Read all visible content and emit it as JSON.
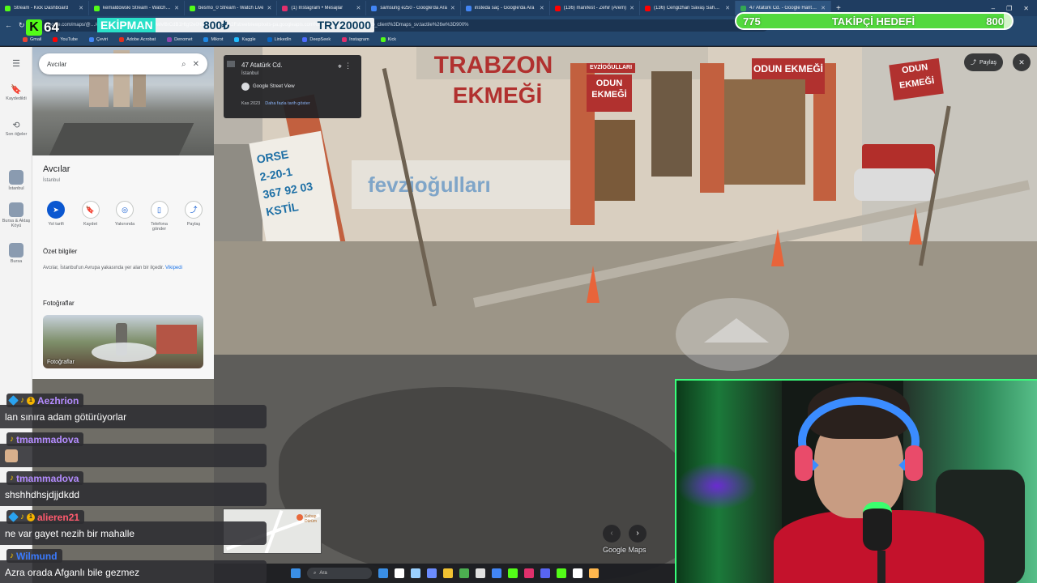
{
  "browser": {
    "tabs": [
      {
        "label": "Stream - Kick Dashboard",
        "color": "#53fc18"
      },
      {
        "label": "kemaldowski Stream - Watch Live",
        "color": "#53fc18"
      },
      {
        "label": "besmo_0 Stream - Watch Live",
        "color": "#53fc18"
      },
      {
        "label": "(1) Instagram • Mesajlar",
        "color": "#e1306c"
      },
      {
        "label": "samsung e250 - Google'da Ara",
        "color": "#4285f4"
      },
      {
        "label": "iristeda saç - Google'da Ara",
        "color": "#4285f4"
      },
      {
        "label": "(136) manifest - Zehir (Arem)",
        "color": "#ff0000"
      },
      {
        "label": "(136) Cengizhan Savaş Sahnesi",
        "color": "#ff0000"
      },
      {
        "label": "47 Atatürk Cd. - Google Haritalar",
        "color": "#34a853",
        "active": true
      }
    ],
    "new_tab": "+",
    "window_controls": [
      "–",
      "❐",
      "✕"
    ],
    "url": "google.com/maps/@…/data=!3m11!1e1!3m9!1s…4wlvf8rCdB1Htg!2e0!6shttps:%2F%2Fstreetviewpixels-pa.googleapis.com%2Fv1%2Fthumbnail%3Fcb_client%3Dmaps_sv.tactile%26w%3D900%",
    "bookmarks": [
      {
        "label": "Gmail",
        "color": "#ea4335"
      },
      {
        "label": "YouTube",
        "color": "#ff0000"
      },
      {
        "label": "Çeviri",
        "color": "#4285f4"
      },
      {
        "label": "Adobe Acrobat",
        "color": "#e0301e"
      },
      {
        "label": "Denomet",
        "color": "#8e44ad"
      },
      {
        "label": "Mikrot",
        "color": "#1e88e5"
      },
      {
        "label": "Kaggle",
        "color": "#20beff"
      },
      {
        "label": "LinkedIn",
        "color": "#0a66c2"
      },
      {
        "label": "DeepSeek",
        "color": "#4d6bfe"
      },
      {
        "label": "Instagram",
        "color": "#e1306c"
      },
      {
        "label": "Kick",
        "color": "#53fc18"
      }
    ]
  },
  "overlay": {
    "kick_logo": "K",
    "kick_count": "64",
    "ekipman_label": "EKİPMAN",
    "ekipman_price": "800₺",
    "ekipman_code": "TRY20000",
    "goal_current": "775",
    "goal_label": "TAKİPÇİ HEDEFİ",
    "goal_target": "800",
    "goal_fraction": 0.97
  },
  "maps": {
    "rail": [
      {
        "icon": "☰",
        "label": ""
      },
      {
        "icon": "🔖",
        "label": "Kaydedildi"
      },
      {
        "icon": "⟲",
        "label": "Son öğeler"
      },
      {
        "thumb": true,
        "label": "İstanbul"
      },
      {
        "thumb": true,
        "label": "Bursa & Aktaş Köyü"
      },
      {
        "thumb": true,
        "label": "Bursa"
      }
    ],
    "search_value": "Avcılar",
    "place_title": "Avcılar",
    "place_subtitle": "İstanbul",
    "actions": [
      {
        "icon": "➤",
        "label": "Yol tarifi"
      },
      {
        "icon": "🔖",
        "label": "Kaydet"
      },
      {
        "icon": "◎",
        "label": "Yakınında"
      },
      {
        "icon": "▯",
        "label": "Telefona gönder"
      },
      {
        "icon": "⤴",
        "label": "Paylaş"
      }
    ],
    "summary_heading": "Özet bilgiler",
    "summary_text": "Avcılar, İstanbul'un Avrupa yakasında yer alan bir ilçedir.",
    "summary_link": "Vikipedi",
    "photos_heading": "Fotoğraflar",
    "photos_tile_label": "Fotoğraflar",
    "collapse": "‹"
  },
  "streetview": {
    "address": "47 Atatürk Cd.",
    "city": "İstanbul",
    "source": "Google Street View",
    "date": "Kas 2023",
    "more_dates": "Daha fazla tarih göster",
    "share": "Paylaş",
    "close": "✕",
    "signs": {
      "top": "TRABZON",
      "ekmegi": "EKMEĞİ",
      "odun1": "ODUN",
      "ekmegi2": "EKMEĞİ",
      "evziogullari": "EVZİOĞULLARI",
      "odun2": "ODUN EKMEĞİ",
      "red_right": "ODUN EKMEĞİ",
      "phone_a": "2-20-1",
      "phone_b": "367 92 03",
      "brand": "fevzioğulları",
      "orse": "ORSE",
      "kstil": "KSTİL"
    },
    "minimap_label": "Kebap Dürüm",
    "logo": "Google Maps",
    "arrow_left": "‹",
    "arrow_right": "›"
  },
  "taskbar": {
    "search_label": "Ara",
    "icon_colors": [
      "#3a8fe6",
      "#ffffff",
      "#9ad0ff",
      "#6b8cff",
      "#f1c232",
      "#4caf50",
      "#e0e0e0",
      "#4285f4",
      "#53fc18",
      "#e1306c",
      "#5865f2",
      "#53fc18",
      "#ffffff",
      "#ffb74d"
    ]
  },
  "chat": [
    {
      "user": "Aezhrion",
      "badges": [
        "mod",
        "note",
        "sub"
      ],
      "text": "lan sınıra adam götürüyorlar"
    },
    {
      "user": "tmammadova",
      "badges": [
        "note"
      ],
      "emote": true,
      "text": ""
    },
    {
      "user": "tmammadova",
      "badges": [
        "note"
      ],
      "text": "shshhdhsjdjjdkdd"
    },
    {
      "user": "alieren21",
      "badges": [
        "mod",
        "note",
        "sub"
      ],
      "text": "ne var gayet nezih bir mahalle"
    },
    {
      "user": "Wilmund",
      "badges": [
        "note"
      ],
      "text": "Azra orada Afganlı bile gezmez"
    }
  ],
  "chat_colors": {
    "user_default": "#b48cff",
    "alieren21": "#ff5a6e",
    "Wilmund": "#3b7bff"
  }
}
